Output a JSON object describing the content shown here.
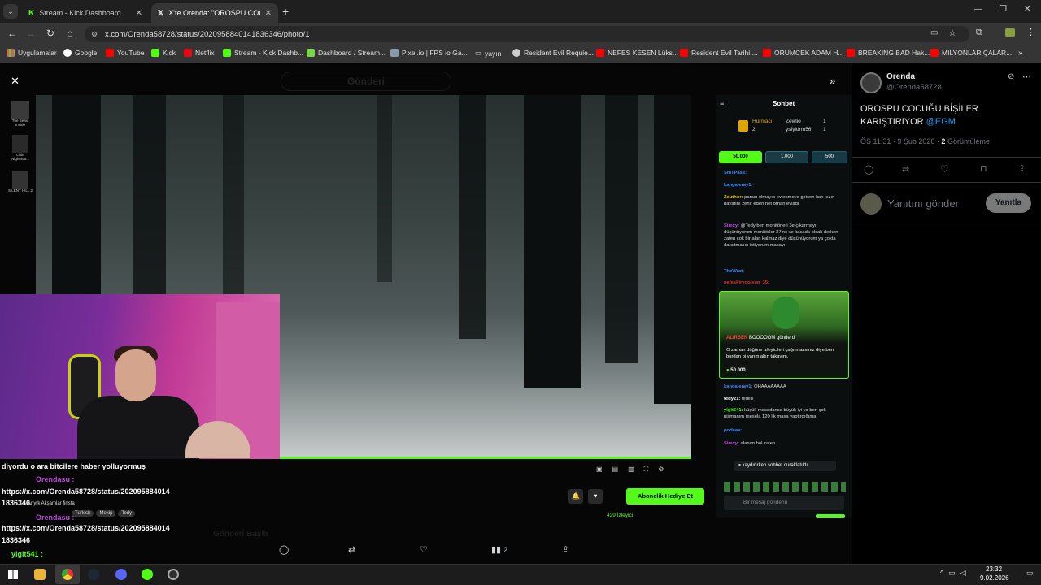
{
  "tabs": [
    {
      "title": "Stream - Kick Dashboard"
    },
    {
      "title": "X'te Orenda: \"OROSPU COCUĞ"
    }
  ],
  "address": {
    "url": "x.com/Orenda58728/status/2020958840141836346/photo/1"
  },
  "bookmarks": [
    "Uygulamalar",
    "Google",
    "YouTube",
    "Kick",
    "Netflix",
    "Stream - Kick Dashb...",
    "Dashboard / Stream...",
    "Pixel.io | FPS io Ga...",
    "yayın",
    "Resident Evil Requie...",
    "NEFES KESEN Lüks...",
    "Resident Evil Tarihi:...",
    "ÖRÜMCEK ADAM H...",
    "BREAKING BAD Hak...",
    "MİLYONLAR ÇALAR..."
  ],
  "viewer": {
    "games": [
      {
        "label": "The Beast Inside"
      },
      {
        "label": "Little Nightmar..."
      },
      {
        "label": "SILENT HILL 2"
      }
    ],
    "faded_header": "Gönderi",
    "faded_reply": "Gönderi Başla",
    "kick": {
      "chat_title": "Sohbet",
      "leaderboard": [
        {
          "name": "Hurmaci",
          "value": "2"
        },
        {
          "name": "Zewlio",
          "value": "1"
        },
        {
          "name": "ysfyldrm56",
          "value": "1"
        }
      ],
      "goals": [
        "50.000",
        "1.000",
        "500"
      ],
      "messages": [
        {
          "user": "SmTPass:",
          "text": ""
        },
        {
          "user": "kangaleray1:",
          "text": ""
        },
        {
          "user": "Zeuthor:",
          "text": "parası olmayıp evlenmeye girişen kan kızın hayatını zehir eden net orhan evladı"
        },
        {
          "user": "Simxy:",
          "text": "@Tedy ben monitörleri 3e çıkarmayı düşünüyorum monitörler 27inç ve kasada olcak derken zaten çok bir alan kalmaz diye düşünüyorum ya çokta daraltmasın istiyorum masayı"
        },
        {
          "user": "TheWrat:",
          "text": ""
        },
        {
          "user": "nefeskiryoolsun_35:",
          "text": ""
        }
      ],
      "gift": {
        "user": "ALIRSEN",
        "action": "BOOOOOM gönderdi",
        "text": "O zaman düğüne izleyicileri çağırmazsınız diye ben burdan bi yarım altın takayım.",
        "amount": "50.000"
      },
      "messages2": [
        {
          "user": "kangaleray1:",
          "text": "OHAAAAAAAA"
        },
        {
          "user": "tedy21:",
          "text": "tedilili"
        },
        {
          "user": "yigit541:",
          "text": "küçük masadansa büyük iyi ya ben çok pişmanım mesela 120 lik masa yaptırdığıma"
        },
        {
          "user": "podaaa:",
          "text": ""
        },
        {
          "user": "Simxy:",
          "text": "alanım bol zaten"
        }
      ],
      "paused": "kaydırırken sohbet duraklatıldı",
      "input_placeholder": "Bir mesaj gönderin",
      "gift_sub_button": "Abonelik Hediye Et",
      "viewers": "429 İzleyici"
    },
    "overlay_chat": [
      {
        "text": "diyordu o ara bitcilere haber yolluyormuş"
      },
      {
        "user": "Orendasu :",
        "text": ""
      },
      {
        "text": "https://x.com/Orenda58728/status/202095884014"
      },
      {
        "text": "1836346"
      },
      {
        "text": "Anyrk Akşamlar finsta"
      },
      {
        "tags": [
          "Turkish",
          "Mekip",
          "Tedy"
        ]
      },
      {
        "user": "Orendasu :",
        "text": ""
      },
      {
        "text": "https://x.com/Orenda58728/status/202095884014"
      },
      {
        "text": "1836346"
      },
      {
        "user": "yigit541 :",
        "text": ""
      }
    ],
    "actions": {
      "views": "2"
    }
  },
  "tweet": {
    "name": "Orenda",
    "handle": "@Orenda58728",
    "text": "OROSPU COCUĞU BİŞİLER KARIŞTIRIYOR",
    "mention": "@EGM",
    "time": "ÖS 11:31 · 9 Şub 2026 ·",
    "views_count": "2",
    "views_label": "Görüntüleme",
    "reply_placeholder": "Yanıtını gönder",
    "reply_button": "Yanıtla"
  },
  "taskbar": {
    "time": "23:32",
    "date": "9.02.2026"
  },
  "colors": {
    "kick_green": "#53fc18",
    "x_blue": "#1d9bf0"
  }
}
